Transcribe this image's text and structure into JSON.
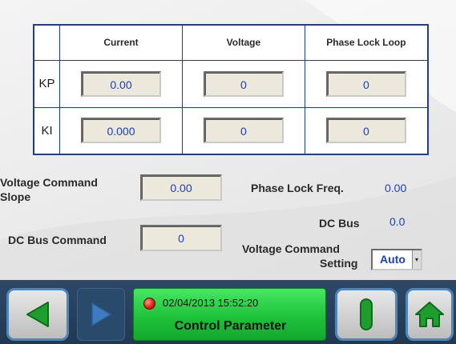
{
  "gain_table": {
    "headers": [
      "",
      "Current",
      "Voltage",
      "Phase Lock Loop"
    ],
    "rows": [
      {
        "label": "KP",
        "values": [
          "0.00",
          "0",
          "0"
        ]
      },
      {
        "label": "KI",
        "values": [
          "0.000",
          "0",
          "0"
        ]
      }
    ]
  },
  "parameters": {
    "voltage_command_slope_label_line1": "Voltage Command",
    "voltage_command_slope_label_line2": "Slope",
    "voltage_command_slope_value": "0.00",
    "dc_bus_command_label": "DC Bus Command",
    "dc_bus_command_value": "0",
    "phase_lock_freq_label": "Phase Lock Freq.",
    "phase_lock_freq_value": "0.00",
    "dc_bus_label": "DC Bus",
    "dc_bus_value": "0.0",
    "voltage_command_setting_label_line1": "Voltage Command",
    "voltage_command_setting_label_line2": "Setting",
    "voltage_command_setting_value": "Auto"
  },
  "status_bar": {
    "datetime": "02/04/2013  15:52:20",
    "screen_title": "Control Parameter"
  },
  "icons": {
    "back": "triangle-left-icon",
    "forward": "triangle-right-icon",
    "status": "red-status-dot-icon",
    "pause": "vertical-bar-icon",
    "home": "home-icon"
  },
  "colors": {
    "table_border": "#1f3f8e",
    "value_text": "#1a3fbf",
    "status_panel": "#1ec23b",
    "button_border": "#4f86b9",
    "nav_arrow": "#1e9e2e"
  }
}
